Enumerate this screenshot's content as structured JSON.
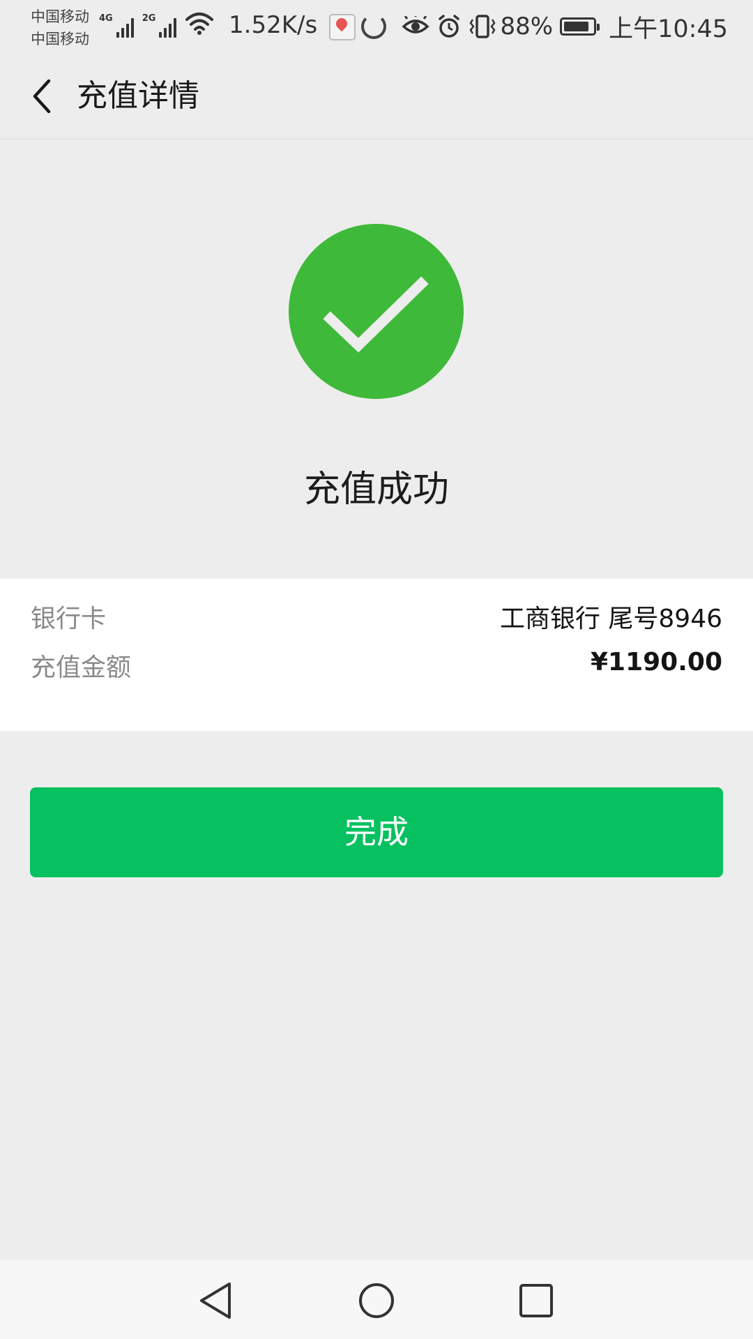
{
  "status_bar": {
    "carrier_1": "中国移动",
    "carrier_2": "中国移动",
    "network_1": "4G",
    "network_2": "2G",
    "net_speed": "1.52K/s",
    "battery_percent": "88%",
    "battery_level": 0.88,
    "time": "上午10:45",
    "icons": [
      "signal-icon",
      "wifi-icon",
      "baidu-maps-icon",
      "loading-icon",
      "eye-icon",
      "alarm-icon",
      "vibrate-icon",
      "battery-icon"
    ]
  },
  "nav": {
    "title": "充值详情",
    "back_icon": "chevron-left-icon"
  },
  "result": {
    "icon": "checkmark-circle-icon",
    "color": "#3fb93a",
    "title": "充值成功"
  },
  "details": {
    "rows": [
      {
        "label": "银行卡",
        "value": "工商银行 尾号8946"
      },
      {
        "label": "充值金额",
        "value": "¥1190.00"
      }
    ]
  },
  "actions": {
    "done_label": "完成",
    "done_color": "#07c160"
  },
  "system_nav": {
    "icons": [
      "back-triangle-icon",
      "home-circle-icon",
      "recents-square-icon"
    ]
  }
}
